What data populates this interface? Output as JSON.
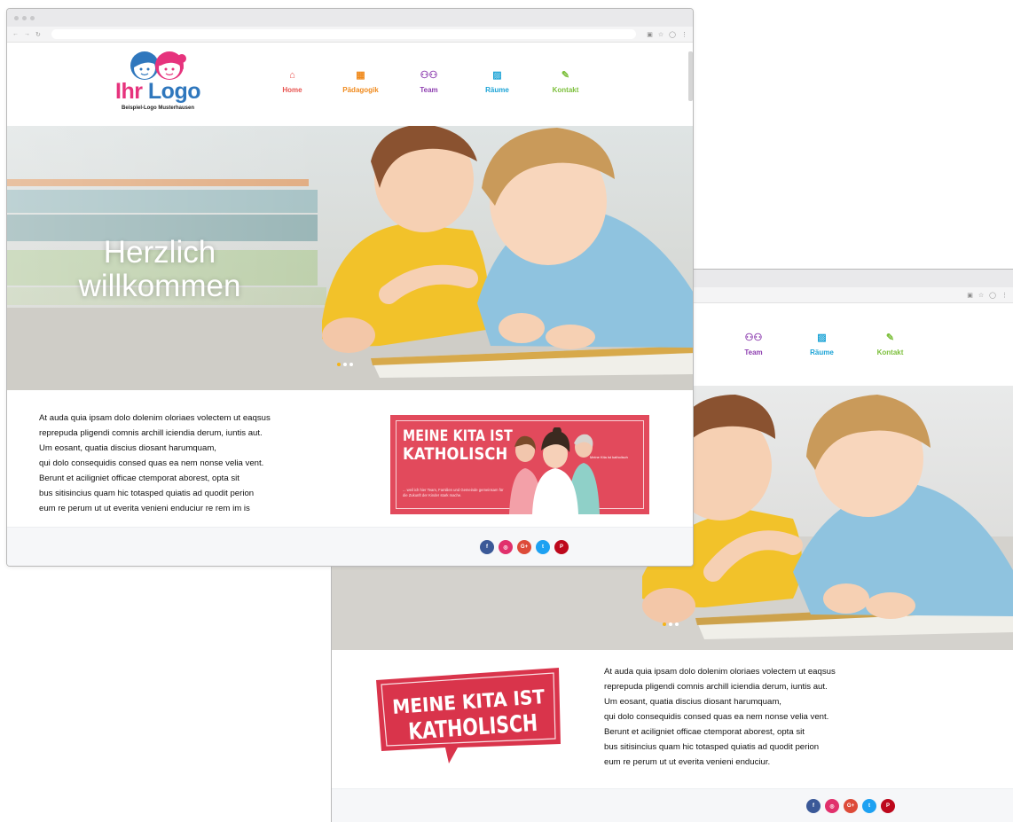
{
  "site": {
    "logo_part1": "Ihr",
    "logo_part2": "Logo",
    "logo_subtitle": "Beispiel-Logo Musterhausen"
  },
  "nav": [
    {
      "label": "Home",
      "icon": "house-icon",
      "color": "#e8534f"
    },
    {
      "label": "Pädagogik",
      "icon": "blocks-icon",
      "color": "#f08a1c"
    },
    {
      "label": "Team",
      "icon": "people-icon",
      "color": "#8e3fb0"
    },
    {
      "label": "Räume",
      "icon": "image-icon",
      "color": "#1ba3d6"
    },
    {
      "label": "Kontakt",
      "icon": "note-icon",
      "color": "#7cbf3b"
    }
  ],
  "hero": {
    "title_line1": "Herzlich",
    "title_line2": "willkommen"
  },
  "body_lines": [
    "At auda quia ipsam dolo dolenim oloriaes volectem ut eaqsus",
    "reprepuda pligendi comnis archill iciendia derum, iuntis aut.",
    "Um eosant, quatia discius diosant harumquam,",
    "qui dolo consequidis consed quas ea nem nonse velia vent.",
    "Berunt et aciligniet officae ctemporat aborest, opta sit",
    "bus sitisincius quam hic totasped quiatis ad quodit perion"
  ],
  "body_last_front": "eum re perum ut ut everita venieni enduciur re rem im is",
  "body_last_back": "eum re perum ut ut everita venieni enduciur.",
  "kita": {
    "line1": "MEINE KITA IST",
    "line2": "KATHOLISCH",
    "banner_small": "... weil ich hier Team, Familien und Gemeinde gemeinsam für die Zukunft der Kinder stark mache.",
    "banner_brand": "Meine Kita ist katholisch"
  },
  "social": [
    {
      "name": "facebook-icon",
      "glyph": "f",
      "color": "#3b5998"
    },
    {
      "name": "instagram-icon",
      "glyph": "◎",
      "color": "#e1306c"
    },
    {
      "name": "googleplus-icon",
      "glyph": "G+",
      "color": "#dd4b39"
    },
    {
      "name": "twitter-icon",
      "glyph": "t",
      "color": "#1da1f2"
    },
    {
      "name": "pinterest-icon",
      "glyph": "P",
      "color": "#bd081c"
    }
  ],
  "colors": {
    "kita_red": "#e24a5c",
    "dot_active": "#f5b418"
  }
}
